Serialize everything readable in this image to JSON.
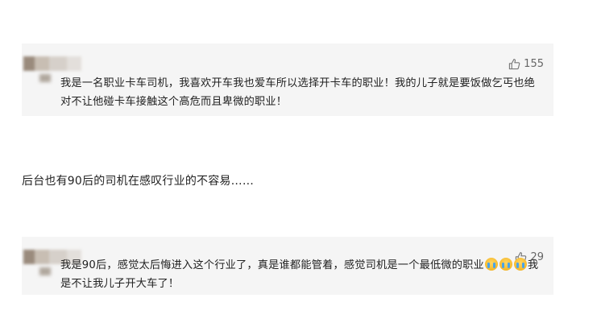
{
  "comments": [
    {
      "likes": "155",
      "text": "我是一名职业卡车司机，我喜欢开车我也爱车所以选择开卡车的职业！我的儿子就是要饭做乞丐也绝对不让他碰卡车接触这个高危而且卑微的职业！"
    },
    {
      "likes": "29",
      "text_before": "我是90后，感觉太后悔进入这个行业了，真是谁都能管着，感觉司机是一个最低微的职业",
      "emoji": [
        "crying-face",
        "crying-face",
        "crying-face"
      ],
      "text_after": "我是不让我儿子开大车了！"
    }
  ],
  "caption": "后台也有90后的司机在感叹行业的不容易……",
  "icons": {
    "like": "thumbs-up-outline-icon"
  },
  "colors": {
    "card_background": "#f5f5f5",
    "text": "#222222",
    "like_text": "#666666"
  }
}
